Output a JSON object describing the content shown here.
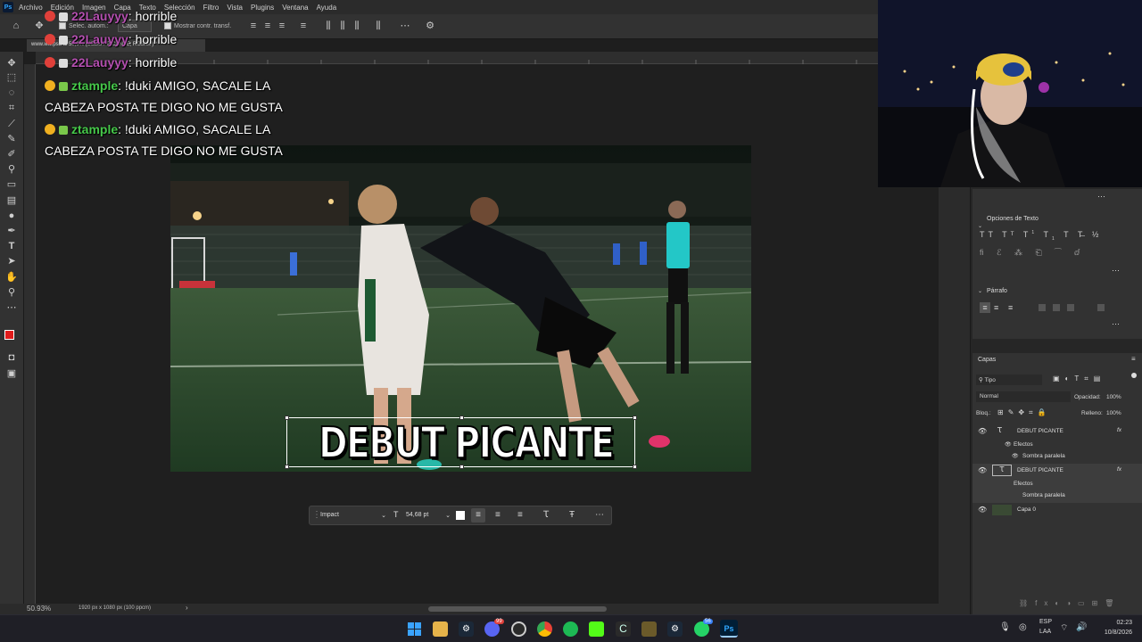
{
  "menu": {
    "logo": "Ps",
    "items": [
      "Archivo",
      "Edición",
      "Imagen",
      "Capa",
      "Texto",
      "Selección",
      "Filtro",
      "Vista",
      "Plugins",
      "Ventana",
      "Ayuda"
    ]
  },
  "options_bar": {
    "auto_select_label": "Selec. autom.:",
    "auto_select_value": "Capa",
    "show_transform_label": "Mostrar contr. transf."
  },
  "document_tab": {
    "title": "www.ww.psd al 50,9% (DEBUT PICANTE, RGB/8#) *"
  },
  "chat": [
    {
      "user": "22Lauyyy",
      "message": ": horrible"
    },
    {
      "user": "22Lauyyy",
      "message": ": horrible"
    },
    {
      "user": "22Lauyyy",
      "message": ": horrible"
    },
    {
      "user": "ztample",
      "message": ": !duki AMIGO, SACALE LA",
      "continuation": "CABEZA POSTA TE DIGO NO ME GUSTA"
    },
    {
      "user": "ztample",
      "message": ": !duki AMIGO, SACALE LA",
      "continuation": "CABEZA POSTA TE DIGO NO ME GUSTA"
    }
  ],
  "canvas": {
    "text_layer": "DEBUT PICANTE"
  },
  "text_toolbar": {
    "font": "Impact",
    "size": "54,68 pt"
  },
  "status_bar": {
    "zoom": "50.93%",
    "doc_info": "1920 px x 1080 px (100 ppcm)"
  },
  "properties_panel": {
    "text_options_title": "Opciones de Texto",
    "paragraph_title": "Párrafo"
  },
  "layers_panel": {
    "title": "Capas",
    "filter": "Tipo",
    "blend_mode": "Normal",
    "opacity_label": "Opacidad:",
    "opacity_value": "100%",
    "lock_label": "Bloq.:",
    "fill_label": "Relleno:",
    "fill_value": "100%",
    "layers": [
      {
        "name": "DEBUT PICANTE",
        "effects_label": "Efectos",
        "effect": "Sombra paralela",
        "fx": "fx"
      },
      {
        "name": "DEBUT PICANTE",
        "effects_label": "Efectos",
        "effect": "Sombra paralela",
        "fx": "fx"
      },
      {
        "name": "Capa 0"
      }
    ]
  },
  "taskbar": {
    "lang": "ESP",
    "lang_sub": "LAA",
    "time": "02:23",
    "date": "10/8/2026",
    "steam_badge": "99",
    "whatsapp_badge": "56"
  }
}
